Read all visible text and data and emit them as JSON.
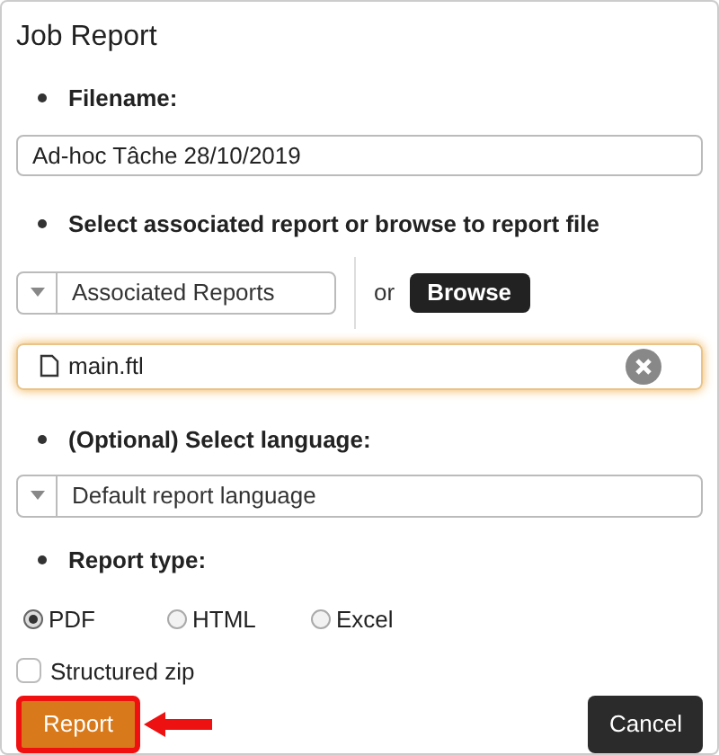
{
  "dialog": {
    "title": "Job Report"
  },
  "filename": {
    "label": "Filename:",
    "value": "Ad-hoc Tâche 28/10/2019"
  },
  "report_source": {
    "label": "Select associated report or browse to report file",
    "select": {
      "value": "Associated Reports"
    },
    "or": "or",
    "browse_button": "Browse",
    "file": {
      "name": "main.ftl",
      "focused": true
    }
  },
  "language": {
    "label": "(Optional) Select language:",
    "select": {
      "value": "Default report language"
    }
  },
  "report_type": {
    "label": "Report type:",
    "options": [
      {
        "label": "PDF",
        "selected": true
      },
      {
        "label": "HTML",
        "selected": false
      },
      {
        "label": "Excel",
        "selected": false
      }
    ]
  },
  "structured_zip": {
    "label": "Structured zip",
    "checked": false
  },
  "buttons": [
    {
      "label": "Report",
      "kind": "primary",
      "highlighted": true
    },
    {
      "label": "Cancel",
      "kind": "secondary",
      "highlighted": false
    }
  ]
}
